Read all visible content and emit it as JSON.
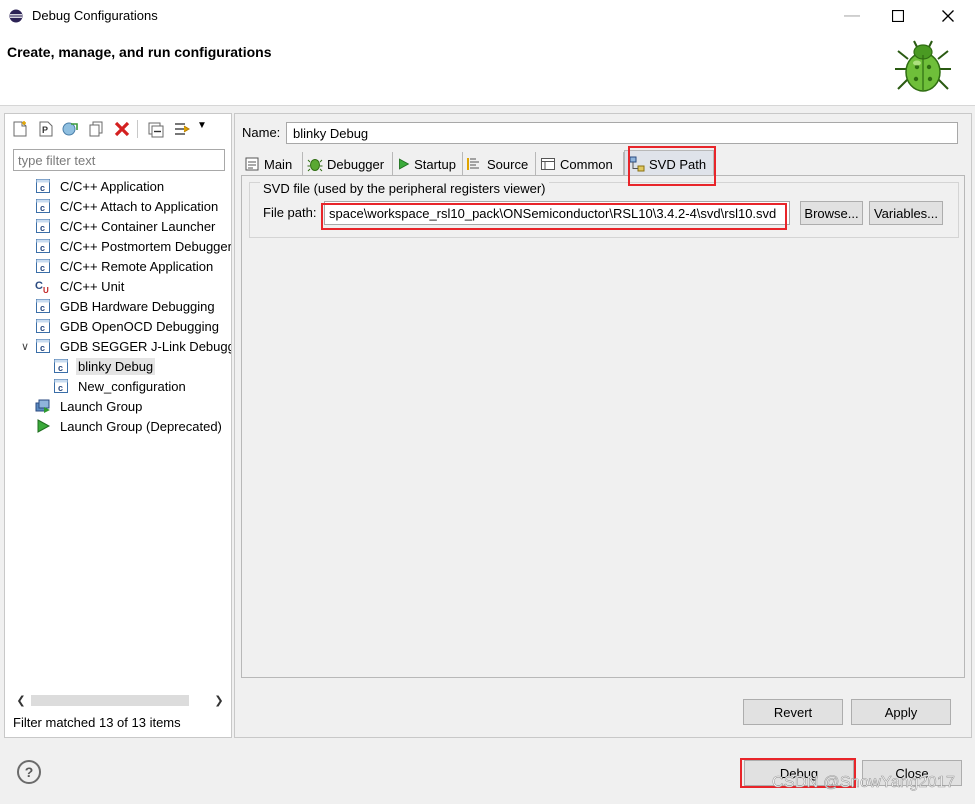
{
  "window": {
    "title": "Debug Configurations",
    "banner_title": "Create, manage, and run configurations"
  },
  "left_panel": {
    "filter_placeholder": "type filter text",
    "tree": [
      {
        "label": "C/C++ Application",
        "icon": "c-config-icon"
      },
      {
        "label": "C/C++ Attach to Application",
        "icon": "c-config-icon"
      },
      {
        "label": "C/C++ Container Launcher",
        "icon": "c-config-icon"
      },
      {
        "label": "C/C++ Postmortem Debugger",
        "icon": "c-config-icon"
      },
      {
        "label": "C/C++ Remote Application",
        "icon": "c-config-icon"
      },
      {
        "label": "C/C++ Unit",
        "icon": "cu-unit-icon"
      },
      {
        "label": "GDB Hardware Debugging",
        "icon": "c-config-icon"
      },
      {
        "label": "GDB OpenOCD Debugging",
        "icon": "c-config-icon"
      },
      {
        "label": "GDB SEGGER J-Link Debugging",
        "icon": "c-config-icon",
        "expanded": true
      },
      {
        "label": "blinky Debug",
        "icon": "c-config-icon",
        "child": true,
        "selected": true
      },
      {
        "label": "New_configuration",
        "icon": "c-config-icon",
        "child": true
      },
      {
        "label": "Launch Group",
        "icon": "launch-group-icon"
      },
      {
        "label": "Launch Group (Deprecated)",
        "icon": "play-icon"
      }
    ],
    "status": "Filter matched 13 of 13 items"
  },
  "right_panel": {
    "name_label": "Name:",
    "name_value": "blinky Debug",
    "tabs": [
      {
        "label": "Main",
        "icon": "main-tab-icon"
      },
      {
        "label": "Debugger",
        "icon": "debugger-bug-icon"
      },
      {
        "label": "Startup",
        "icon": "startup-play-icon"
      },
      {
        "label": "Source",
        "icon": "source-icon"
      },
      {
        "label": "Common",
        "icon": "common-icon"
      },
      {
        "label": "SVD Path",
        "icon": "svd-path-icon",
        "active": true
      }
    ],
    "svd_group_title": "SVD file (used by the peripheral registers viewer)",
    "file_path_label": "File path:",
    "file_path_value": "space\\workspace_rsl10_pack\\ONSemiconductor\\RSL10\\3.4.2-4\\svd\\rsl10.svd",
    "browse_label": "Browse...",
    "variables_label": "Variables...",
    "revert_label": "Revert",
    "apply_label": "Apply"
  },
  "bottom": {
    "debug_label": "Debug",
    "close_label": "Close"
  },
  "watermark": "CSDN @SnowYang2017",
  "colors": {
    "highlight_red": "#e8252a",
    "selected_bg": "#e4e4e4",
    "active_tab_bg": "#dfe3ea"
  }
}
